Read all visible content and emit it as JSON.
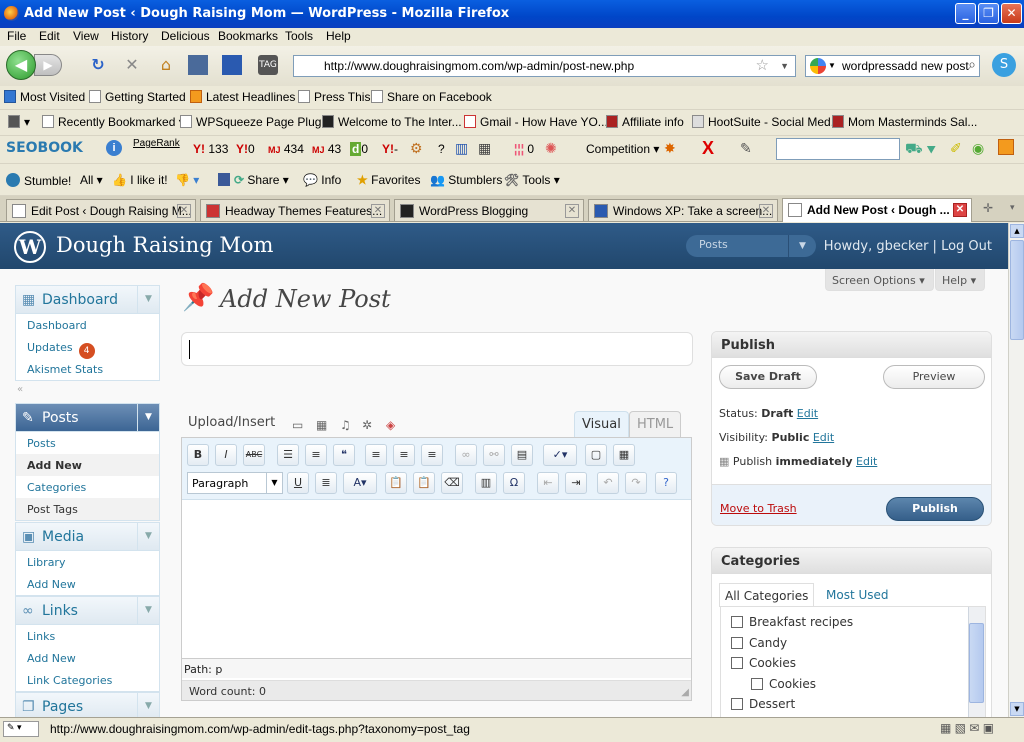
{
  "window": {
    "title": "Add New Post ‹ Dough Raising Mom — WordPress - Mozilla Firefox",
    "min": "_",
    "max": "❐",
    "close": "✕"
  },
  "menu": [
    "File",
    "Edit",
    "View",
    "History",
    "Delicious",
    "Bookmarks",
    "Tools",
    "Help"
  ],
  "nav": {
    "url": "http://www.doughraisingmom.com/wp-admin/post-new.php",
    "search_value": "wordpressadd new post"
  },
  "bookmarks1": [
    "Most Visited",
    "Getting Started",
    "Latest Headlines",
    "Press This",
    "Share on Facebook"
  ],
  "bookmarks2": [
    "Recently Bookmarked ▾",
    "WPSqueeze Page Plug...",
    "Welcome to The Inter...",
    "Gmail - How Have YO...",
    "Affiliate info",
    "HootSuite - Social Med...",
    "Mom Masterminds Sal..."
  ],
  "seobar": {
    "brand": "SEOBOOK",
    "pagerank": "PageRank",
    "y133": "133",
    "y0": "0",
    "mj434": "434",
    "mj43": "43",
    "d0": "0",
    "ydash": "-",
    "q": "?",
    "c0": "0",
    "competition": "Competition"
  },
  "stumblebar": [
    "Stumble!",
    "All ▾",
    "I like it!",
    "Share ▾",
    "Info",
    "Favorites",
    "Stumblers",
    "Tools ▾"
  ],
  "tabs": [
    {
      "label": "Edit Post ‹ Dough Raising M..."
    },
    {
      "label": "Headway Themes Features..."
    },
    {
      "label": "WordPress Blogging"
    },
    {
      "label": "Windows XP: Take a screen..."
    },
    {
      "label": "Add New Post ‹ Dough ..."
    }
  ],
  "wp": {
    "site_name": "Dough Raising Mom",
    "posts_dd": "Posts",
    "howdy": "Howdy, gbecker | Log Out",
    "screen_options": "Screen Options ▾",
    "help": "Help ▾",
    "page_title": "Add New Post",
    "upload_label": "Upload/Insert",
    "tab_visual": "Visual",
    "tab_html": "HTML",
    "paragraph": "Paragraph",
    "path": "Path: p",
    "word_count": "Word count: 0"
  },
  "sidebar": {
    "dashboard": {
      "title": "Dashboard",
      "items": [
        "Dashboard",
        "Updates",
        "Akismet Stats"
      ],
      "updates_badge": "4"
    },
    "posts": {
      "title": "Posts",
      "items": [
        "Posts",
        "Add New",
        "Categories",
        "Post Tags"
      ]
    },
    "media": {
      "title": "Media",
      "items": [
        "Library",
        "Add New"
      ]
    },
    "links": {
      "title": "Links",
      "items": [
        "Links",
        "Add New",
        "Link Categories"
      ]
    },
    "pages": {
      "title": "Pages"
    }
  },
  "publish": {
    "title": "Publish",
    "save_draft": "Save Draft",
    "preview": "Preview",
    "status_label": "Status:",
    "status_value": "Draft",
    "edit": "Edit",
    "visibility_label": "Visibility:",
    "visibility_value": "Public",
    "publish_label": "Publish",
    "publish_value": "immediately",
    "trash": "Move to Trash",
    "publish_btn": "Publish"
  },
  "categories": {
    "title": "Categories",
    "tab_all": "All Categories",
    "tab_used": "Most Used",
    "items": [
      "Breakfast recipes",
      "Candy",
      "Cookies",
      "Cookies",
      "Dessert"
    ]
  },
  "status": {
    "url": "http://www.doughraisingmom.com/wp-admin/edit-tags.php?taxonomy=post_tag"
  }
}
